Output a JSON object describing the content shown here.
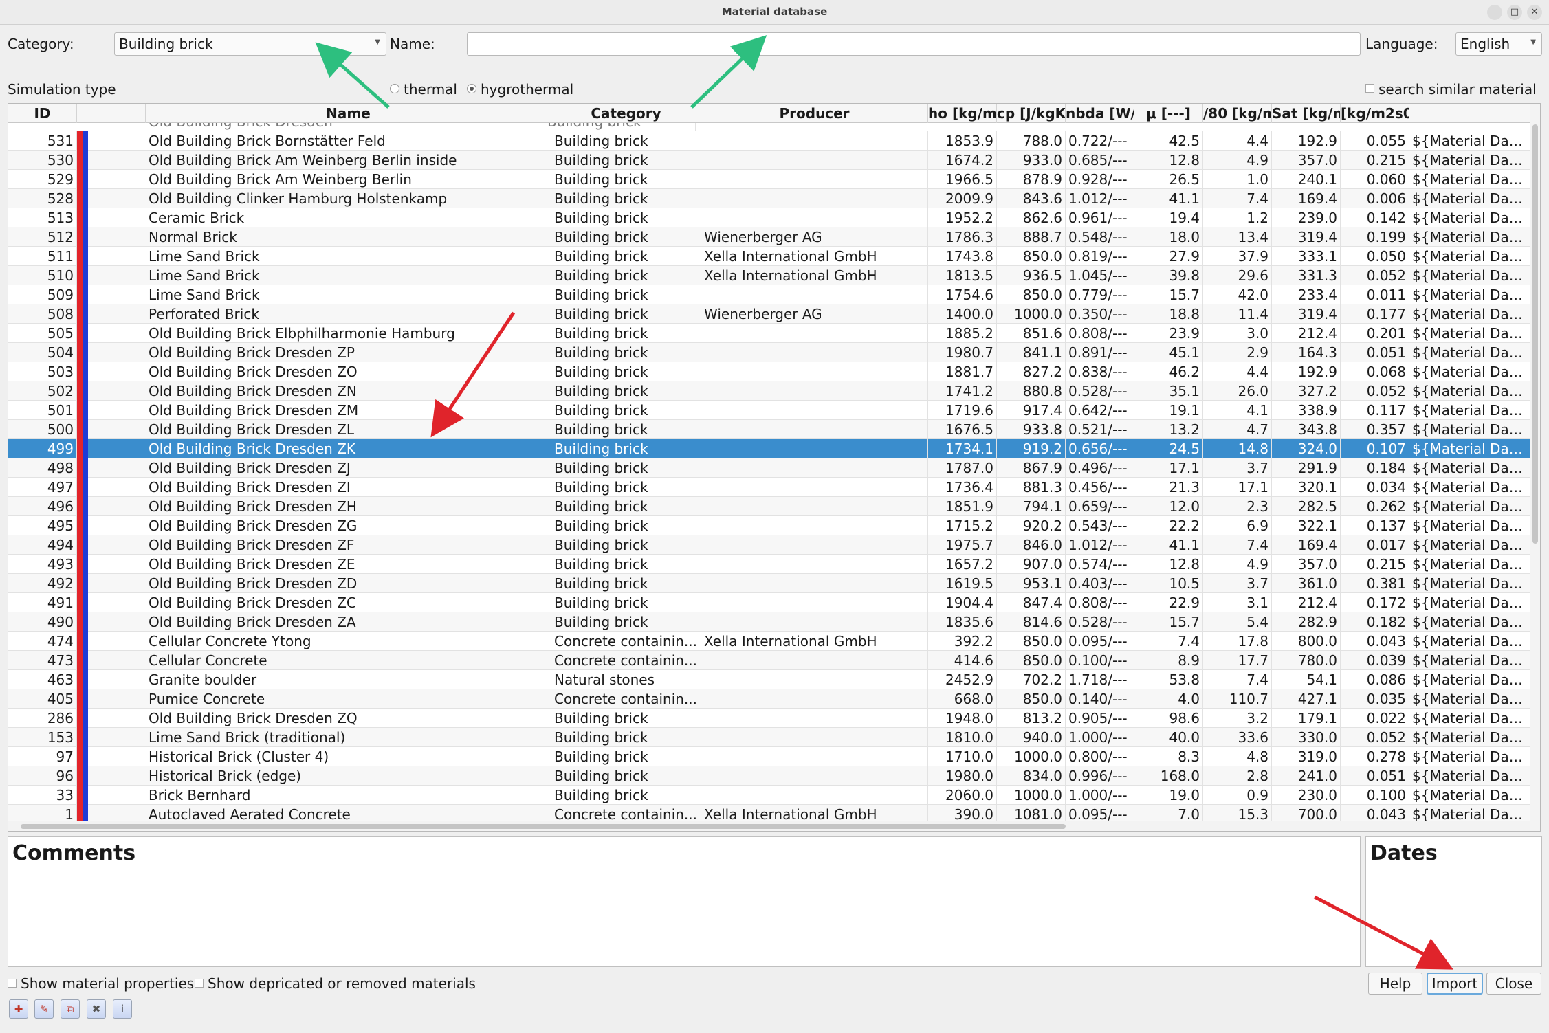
{
  "window": {
    "title": "Material database"
  },
  "filters": {
    "category_label": "Category:",
    "category_value": "Building brick",
    "name_label": "Name:",
    "name_value": "",
    "language_label": "Language:",
    "language_value": "English",
    "simulation_type_label": "Simulation type",
    "thermal_label": "thermal",
    "hygrothermal_label": "hygrothermal",
    "simulation_type_selected": "hygrothermal",
    "search_similar_label": "search similar material"
  },
  "table": {
    "columns": [
      "ID",
      "",
      "Name",
      "Category",
      "Producer",
      "ho [kg/m³",
      "cp [J/kgK]",
      "nbda [W/n",
      "μ [---]",
      "/80 [kg/m³",
      "Sat [kg/m",
      "[kg/m2s0",
      ""
    ],
    "partial_row": [
      "",
      "Old Building Brick Dresden",
      "Building brick"
    ],
    "selected_id": "499",
    "rows": [
      [
        "531",
        "Old Building Brick Bornstätter Feld",
        "Building brick",
        "",
        "1853.9",
        "788.0",
        "0.722/---",
        "42.5",
        "4.4",
        "192.9",
        "0.055",
        "${Material Database"
      ],
      [
        "530",
        "Old Building Brick Am Weinberg Berlin inside",
        "Building brick",
        "",
        "1674.2",
        "933.0",
        "0.685/---",
        "12.8",
        "4.9",
        "357.0",
        "0.215",
        "${Material Database"
      ],
      [
        "529",
        "Old Building Brick Am Weinberg Berlin",
        "Building brick",
        "",
        "1966.5",
        "878.9",
        "0.928/---",
        "26.5",
        "1.0",
        "240.1",
        "0.060",
        "${Material Database"
      ],
      [
        "528",
        "Old Building Clinker Hamburg Holstenkamp",
        "Building brick",
        "",
        "2009.9",
        "843.6",
        "1.012/---",
        "41.1",
        "7.4",
        "169.4",
        "0.006",
        "${Material Database"
      ],
      [
        "513",
        "Ceramic Brick",
        "Building brick",
        "",
        "1952.2",
        "862.6",
        "0.961/---",
        "19.4",
        "1.2",
        "239.0",
        "0.142",
        "${Material Database"
      ],
      [
        "512",
        "Normal Brick",
        "Building brick",
        "Wienerberger AG",
        "1786.3",
        "888.7",
        "0.548/---",
        "18.0",
        "13.4",
        "319.4",
        "0.199",
        "${Material Database"
      ],
      [
        "511",
        "Lime Sand Brick",
        "Building brick",
        "Xella International GmbH",
        "1743.8",
        "850.0",
        "0.819/---",
        "27.9",
        "37.9",
        "333.1",
        "0.050",
        "${Material Database"
      ],
      [
        "510",
        "Lime Sand Brick",
        "Building brick",
        "Xella International GmbH",
        "1813.5",
        "936.5",
        "1.045/---",
        "39.8",
        "29.6",
        "331.3",
        "0.052",
        "${Material Database"
      ],
      [
        "509",
        "Lime Sand Brick",
        "Building brick",
        "",
        "1754.6",
        "850.0",
        "0.779/---",
        "15.7",
        "42.0",
        "233.4",
        "0.011",
        "${Material Database"
      ],
      [
        "508",
        "Perforated Brick",
        "Building brick",
        "Wienerberger AG",
        "1400.0",
        "1000.0",
        "0.350/---",
        "18.8",
        "11.4",
        "319.4",
        "0.177",
        "${Material Database"
      ],
      [
        "505",
        "Old Building Brick Elbphilharmonie Hamburg",
        "Building brick",
        "",
        "1885.2",
        "851.6",
        "0.808/---",
        "23.9",
        "3.0",
        "212.4",
        "0.201",
        "${Material Database"
      ],
      [
        "504",
        "Old Building Brick Dresden ZP",
        "Building brick",
        "",
        "1980.7",
        "841.1",
        "0.891/---",
        "45.1",
        "2.9",
        "164.3",
        "0.051",
        "${Material Database"
      ],
      [
        "503",
        "Old Building Brick Dresden ZO",
        "Building brick",
        "",
        "1881.7",
        "827.2",
        "0.838/---",
        "46.2",
        "4.4",
        "192.9",
        "0.068",
        "${Material Database"
      ],
      [
        "502",
        "Old Building Brick Dresden ZN",
        "Building brick",
        "",
        "1741.2",
        "880.8",
        "0.528/---",
        "35.1",
        "26.0",
        "327.2",
        "0.052",
        "${Material Database"
      ],
      [
        "501",
        "Old Building Brick Dresden ZM",
        "Building brick",
        "",
        "1719.6",
        "917.4",
        "0.642/---",
        "19.1",
        "4.1",
        "338.9",
        "0.117",
        "${Material Database"
      ],
      [
        "500",
        "Old Building Brick Dresden ZL",
        "Building brick",
        "",
        "1676.5",
        "933.8",
        "0.521/---",
        "13.2",
        "4.7",
        "343.8",
        "0.357",
        "${Material Database"
      ],
      [
        "499",
        "Old Building Brick Dresden ZK",
        "Building brick",
        "",
        "1734.1",
        "919.2",
        "0.656/---",
        "24.5",
        "14.8",
        "324.0",
        "0.107",
        "${Material Database"
      ],
      [
        "498",
        "Old Building Brick Dresden ZJ",
        "Building brick",
        "",
        "1787.0",
        "867.9",
        "0.496/---",
        "17.1",
        "3.7",
        "291.9",
        "0.184",
        "${Material Database"
      ],
      [
        "497",
        "Old Building Brick Dresden ZI",
        "Building brick",
        "",
        "1736.4",
        "881.3",
        "0.456/---",
        "21.3",
        "17.1",
        "320.1",
        "0.034",
        "${Material Database"
      ],
      [
        "496",
        "Old Building Brick Dresden ZH",
        "Building brick",
        "",
        "1851.9",
        "794.1",
        "0.659/---",
        "12.0",
        "2.3",
        "282.5",
        "0.262",
        "${Material Database"
      ],
      [
        "495",
        "Old Building Brick Dresden ZG",
        "Building brick",
        "",
        "1715.2",
        "920.2",
        "0.543/---",
        "22.2",
        "6.9",
        "322.1",
        "0.137",
        "${Material Database"
      ],
      [
        "494",
        "Old Building Brick Dresden ZF",
        "Building brick",
        "",
        "1975.7",
        "846.0",
        "1.012/---",
        "41.1",
        "7.4",
        "169.4",
        "0.017",
        "${Material Database"
      ],
      [
        "493",
        "Old Building Brick Dresden ZE",
        "Building brick",
        "",
        "1657.2",
        "907.0",
        "0.574/---",
        "12.8",
        "4.9",
        "357.0",
        "0.215",
        "${Material Database"
      ],
      [
        "492",
        "Old Building Brick Dresden ZD",
        "Building brick",
        "",
        "1619.5",
        "953.1",
        "0.403/---",
        "10.5",
        "3.7",
        "361.0",
        "0.381",
        "${Material Database"
      ],
      [
        "491",
        "Old Building Brick Dresden ZC",
        "Building brick",
        "",
        "1904.4",
        "847.4",
        "0.808/---",
        "22.9",
        "3.1",
        "212.4",
        "0.172",
        "${Material Database"
      ],
      [
        "490",
        "Old Building Brick Dresden ZA",
        "Building brick",
        "",
        "1835.6",
        "814.6",
        "0.528/---",
        "15.7",
        "5.4",
        "282.9",
        "0.182",
        "${Material Database"
      ],
      [
        "474",
        "Cellular Concrete Ytong",
        "Concrete containin...",
        "Xella International GmbH",
        "392.2",
        "850.0",
        "0.095/---",
        "7.4",
        "17.8",
        "800.0",
        "0.043",
        "${Material Database"
      ],
      [
        "473",
        "Cellular Concrete",
        "Concrete containin...",
        "",
        "414.6",
        "850.0",
        "0.100/---",
        "8.9",
        "17.7",
        "780.0",
        "0.039",
        "${Material Database"
      ],
      [
        "463",
        "Granite boulder",
        "Natural stones",
        "",
        "2452.9",
        "702.2",
        "1.718/---",
        "53.8",
        "7.4",
        "54.1",
        "0.086",
        "${Material Database"
      ],
      [
        "405",
        "Pumice Concrete",
        "Concrete containin...",
        "",
        "668.0",
        "850.0",
        "0.140/---",
        "4.0",
        "110.7",
        "427.1",
        "0.035",
        "${Material Database"
      ],
      [
        "286",
        "Old Building Brick Dresden ZQ",
        "Building brick",
        "",
        "1948.0",
        "813.2",
        "0.905/---",
        "98.6",
        "3.2",
        "179.1",
        "0.022",
        "${Material Database"
      ],
      [
        "153",
        "Lime Sand Brick (traditional)",
        "Building brick",
        "",
        "1810.0",
        "940.0",
        "1.000/---",
        "40.0",
        "33.6",
        "330.0",
        "0.052",
        "${Material Database"
      ],
      [
        "97",
        "Historical Brick (Cluster 4)",
        "Building brick",
        "",
        "1710.0",
        "1000.0",
        "0.800/---",
        "8.3",
        "4.8",
        "319.0",
        "0.278",
        "${Material Database"
      ],
      [
        "96",
        "Historical Brick (edge)",
        "Building brick",
        "",
        "1980.0",
        "834.0",
        "0.996/---",
        "168.0",
        "2.8",
        "241.0",
        "0.051",
        "${Material Database"
      ],
      [
        "33",
        "Brick Bernhard",
        "Building brick",
        "",
        "2060.0",
        "1000.0",
        "1.000/---",
        "19.0",
        "0.9",
        "230.0",
        "0.100",
        "${Material Database"
      ],
      [
        "1",
        "Autoclaved Aerated Concrete",
        "Concrete containin...",
        "Xella International GmbH",
        "390.0",
        "1081.0",
        "0.095/---",
        "7.0",
        "15.3",
        "700.0",
        "0.043",
        "${Material Database"
      ]
    ]
  },
  "panels": {
    "comments_title": "Comments",
    "dates_title": "Dates"
  },
  "bottom": {
    "show_props_label": "Show material properties",
    "show_deprecated_label": "Show depricated or removed materials",
    "help_label": "Help",
    "import_label": "Import",
    "close_label": "Close"
  },
  "toolbar_icons": [
    "new-material-icon",
    "edit-material-icon",
    "copy-material-icon",
    "delete-material-icon",
    "info-icon"
  ],
  "colors": {
    "selection": "#3a8dcd",
    "swatch_red": "#e3242b",
    "swatch_blue": "#1f3bd6",
    "arrow_green": "#2dbf7f",
    "arrow_red": "#e0242b"
  }
}
